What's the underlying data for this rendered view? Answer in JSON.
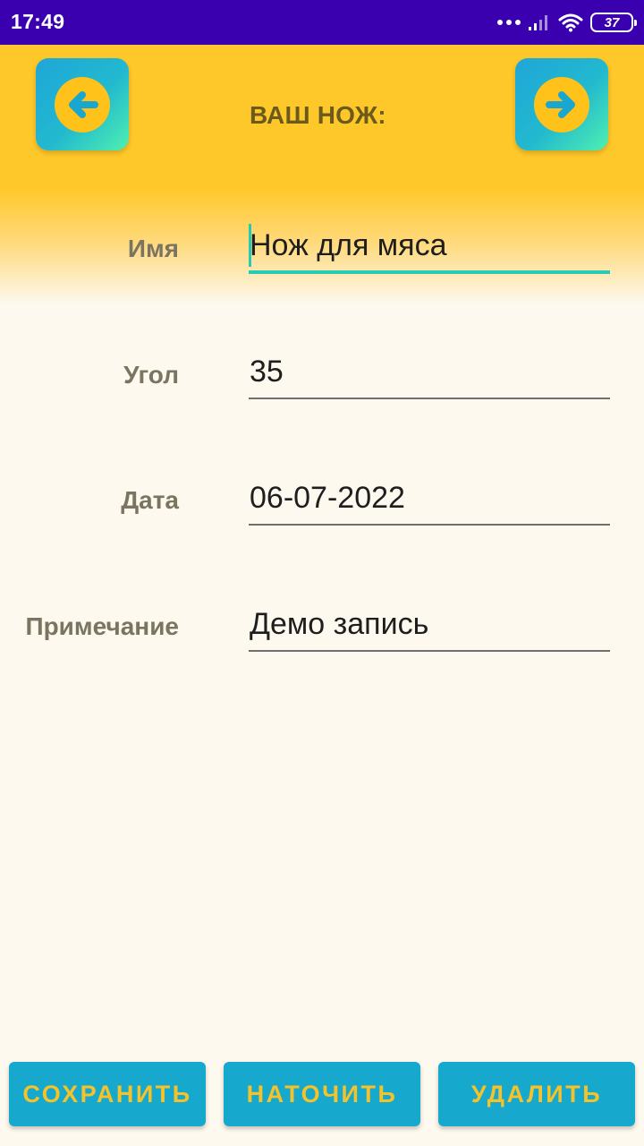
{
  "status_bar": {
    "time": "17:49",
    "battery": "37"
  },
  "header": {
    "title": "ВАШ НОЖ:",
    "back_icon": "arrow-left-circle-icon",
    "forward_icon": "arrow-right-circle-icon"
  },
  "form": {
    "name_label": "Имя",
    "name_value": "Нож для мяса",
    "angle_label": "Угол",
    "angle_value": "35",
    "date_label": "Дата",
    "date_value": "06-07-2022",
    "note_label": "Примечание",
    "note_value": "Демо запись"
  },
  "actions": {
    "save_label": "СОХРАНИТЬ",
    "sharpen_label": "НАТОЧИТЬ",
    "delete_label": "УДАЛИТЬ"
  },
  "colors": {
    "status_bar": "#3a00b0",
    "header": "#ffc82a",
    "background": "#fdf9ee",
    "accent": "#27cbb4",
    "button": "#16a9cd",
    "button_text": "#f5c22a"
  }
}
